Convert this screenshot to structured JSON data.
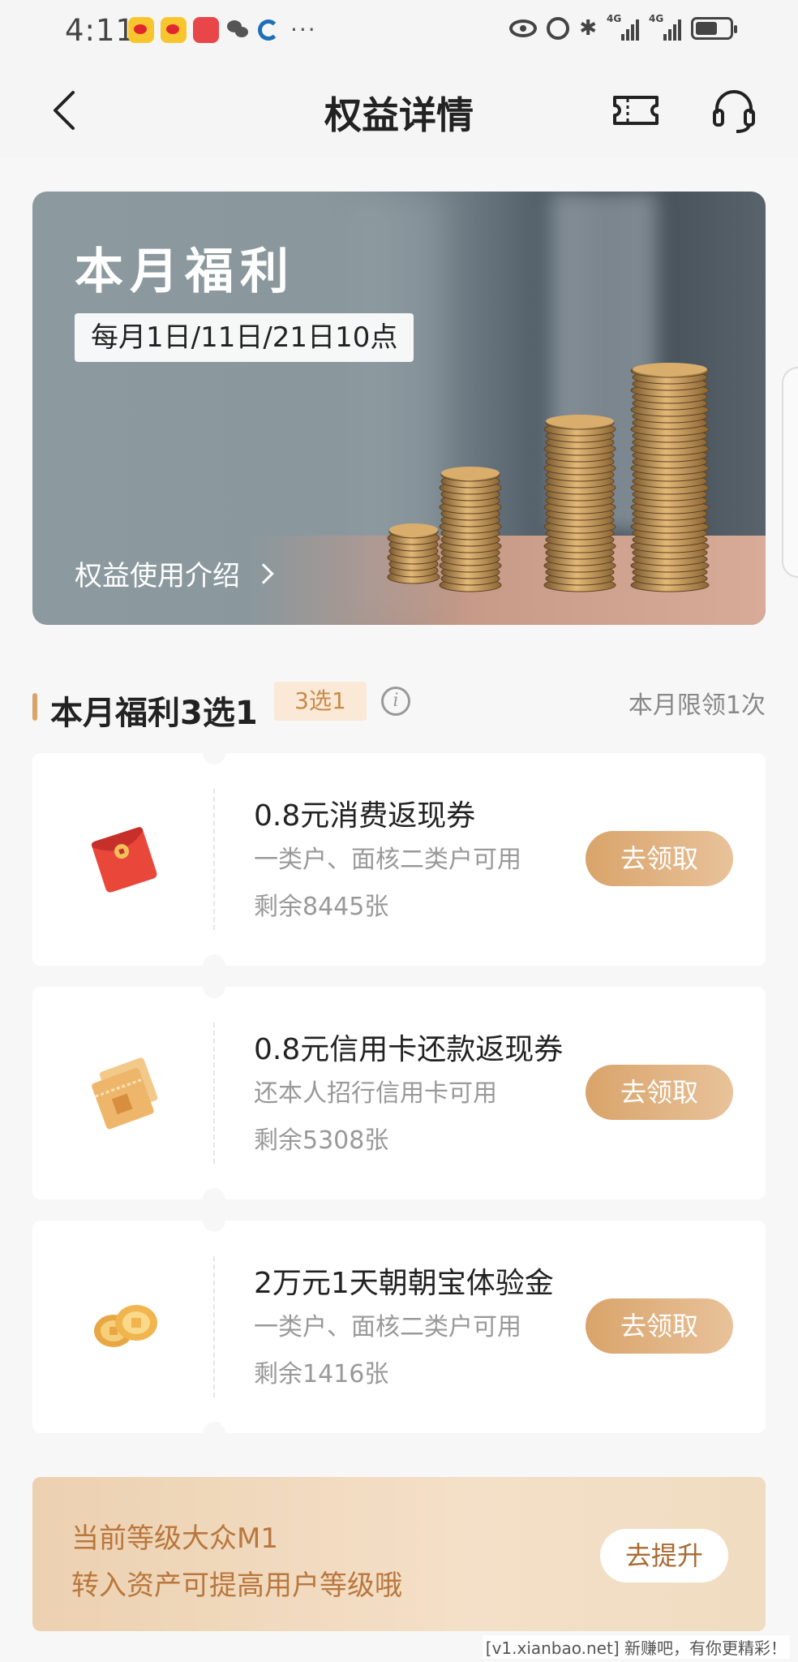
{
  "status_bar": {
    "time": "4:11",
    "more": "···",
    "bluetooth": "✱",
    "network_label": "4G"
  },
  "nav": {
    "title": "权益详情"
  },
  "banner": {
    "title": "本月福利",
    "schedule": "每月1日/11日/21日10点",
    "link": "权益使用介绍"
  },
  "section": {
    "title": "本月福利3选1",
    "tag": "3选1",
    "info": "i",
    "limit": "本月限领1次"
  },
  "coupons": [
    {
      "title": "0.8元消费返现券",
      "desc": "一类户、面核二类户可用",
      "stock": "剩余8445张",
      "button": "去领取",
      "icon": "red-envelope-icon"
    },
    {
      "title": "0.8元信用卡还款返现券",
      "desc": "还本人招行信用卡可用",
      "stock": "剩余5308张",
      "button": "去领取",
      "icon": "ticket-icon"
    },
    {
      "title": "2万元1天朝朝宝体验金",
      "desc": "一类户、面核二类户可用",
      "stock": "剩余1416张",
      "button": "去领取",
      "icon": "coins-icon"
    }
  ],
  "level": {
    "line1": "当前等级大众M1",
    "line2": "转入资产可提高用户等级哦",
    "button": "去提升"
  },
  "watermark": "[v1.xianbao.net] 新赚吧，有你更精彩！",
  "colors": {
    "accent": "#d9a46a",
    "tag_bg": "#fbe9d7",
    "level_text": "#b9773d"
  }
}
